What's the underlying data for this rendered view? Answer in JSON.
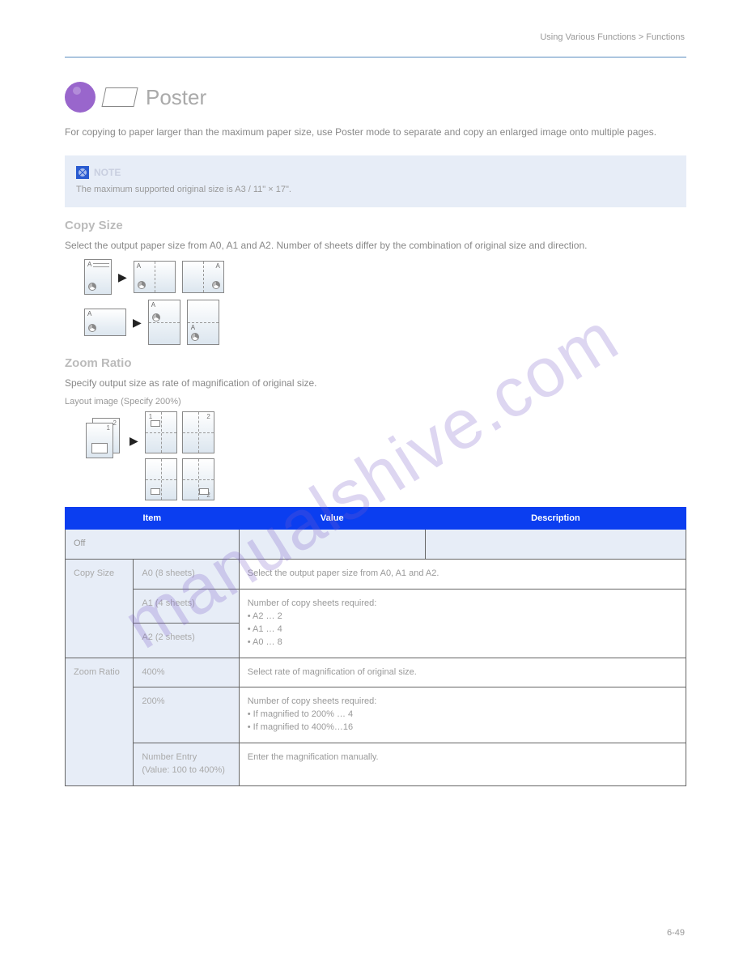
{
  "header": {
    "text": "Using Various Functions > Functions"
  },
  "title": "Poster",
  "lead": "For copying to paper larger than the maximum paper size, use Poster mode to separate and copy an enlarged image onto multiple pages.",
  "note": {
    "label": "NOTE",
    "text": "The maximum supported original size is A3 / 11\" × 17\"."
  },
  "sections": {
    "copysize": {
      "heading": "Copy Size",
      "body": "Select the output paper size from A0, A1 and A2. Number of sheets differ by the combination of original size and direction."
    },
    "ratio": {
      "heading": "Zoom Ratio",
      "body": "Specify output size as rate of magnification of original size.",
      "layout_label": "Layout image (Specify 200%)"
    }
  },
  "table": {
    "headers": [
      "Item",
      "Value",
      "Description"
    ],
    "rows": [
      {
        "item": "Off",
        "value": "",
        "desc": "",
        "off": true
      },
      {
        "item_group": "Copy Size",
        "rows": [
          {
            "value": "A0 (8 sheets)",
            "desc": "Select the output paper size from A0, A1 and A2."
          },
          {
            "value": "A1 (4 sheets)",
            "desc": "Number of copy sheets required:\n• A2 … 2\n• A1 … 4\n• A0 … 8"
          },
          {
            "value": "A2 (2 sheets)",
            "desc": ""
          }
        ]
      },
      {
        "item_group": "Zoom Ratio",
        "rows": [
          {
            "value": "400%",
            "desc": "Select rate of magnification of original size."
          },
          {
            "value": "200%",
            "desc": "Number of copy sheets required:\n• If magnified to 200% … 4\n• If magnified to 400%…16"
          },
          {
            "value": "Number Entry\n(Value: 100 to 400%)",
            "desc": "Enter the magnification manually."
          }
        ]
      }
    ]
  },
  "pagenum": "6-49",
  "watermark": "manualshive.com"
}
